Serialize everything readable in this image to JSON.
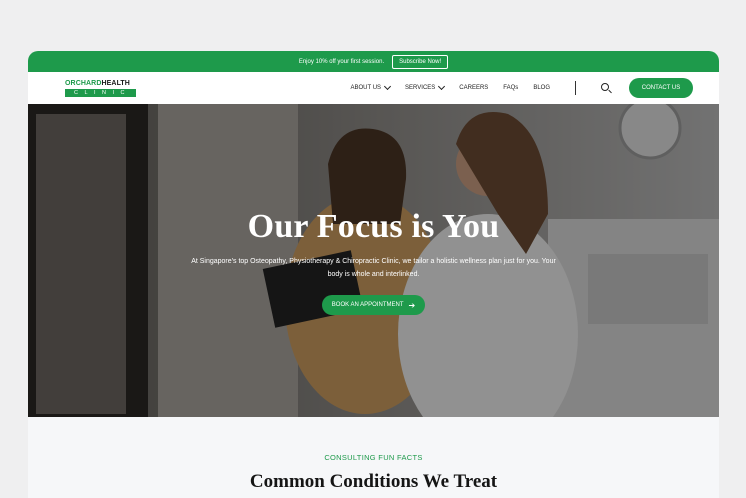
{
  "promo": {
    "text": "Enjoy 10% off your first session.",
    "button_label": "Subscribe Now!"
  },
  "logo": {
    "word1": "ORCHARD",
    "word2": "HEALTH",
    "word3": "CLINIC"
  },
  "nav": {
    "items": [
      {
        "label": "ABOUT US",
        "dropdown": true
      },
      {
        "label": "SERVICES",
        "dropdown": true
      },
      {
        "label": "CAREERS",
        "dropdown": false
      },
      {
        "label": "FAQs",
        "dropdown": false
      },
      {
        "label": "BLOG",
        "dropdown": false
      }
    ],
    "contact_label": "CONTACT US"
  },
  "hero": {
    "title": "Our Focus is You",
    "subtitle": "At Singapore's top Osteopathy, Physiotherapy & Chiropractic Clinic, we tailor a holistic wellness plan just for you. Your body is whole and interlinked.",
    "button_label": "BOOK AN APPOINTMENT",
    "button_icon": "arrow-right-icon"
  },
  "facts": {
    "eyebrow": "CONSULTING FUN FACTS",
    "heading": "Common Conditions We Treat"
  },
  "colors": {
    "brand_green": "#1e9a4b",
    "page_bg": "#efeff0",
    "section_bg": "#f6f7f9"
  }
}
